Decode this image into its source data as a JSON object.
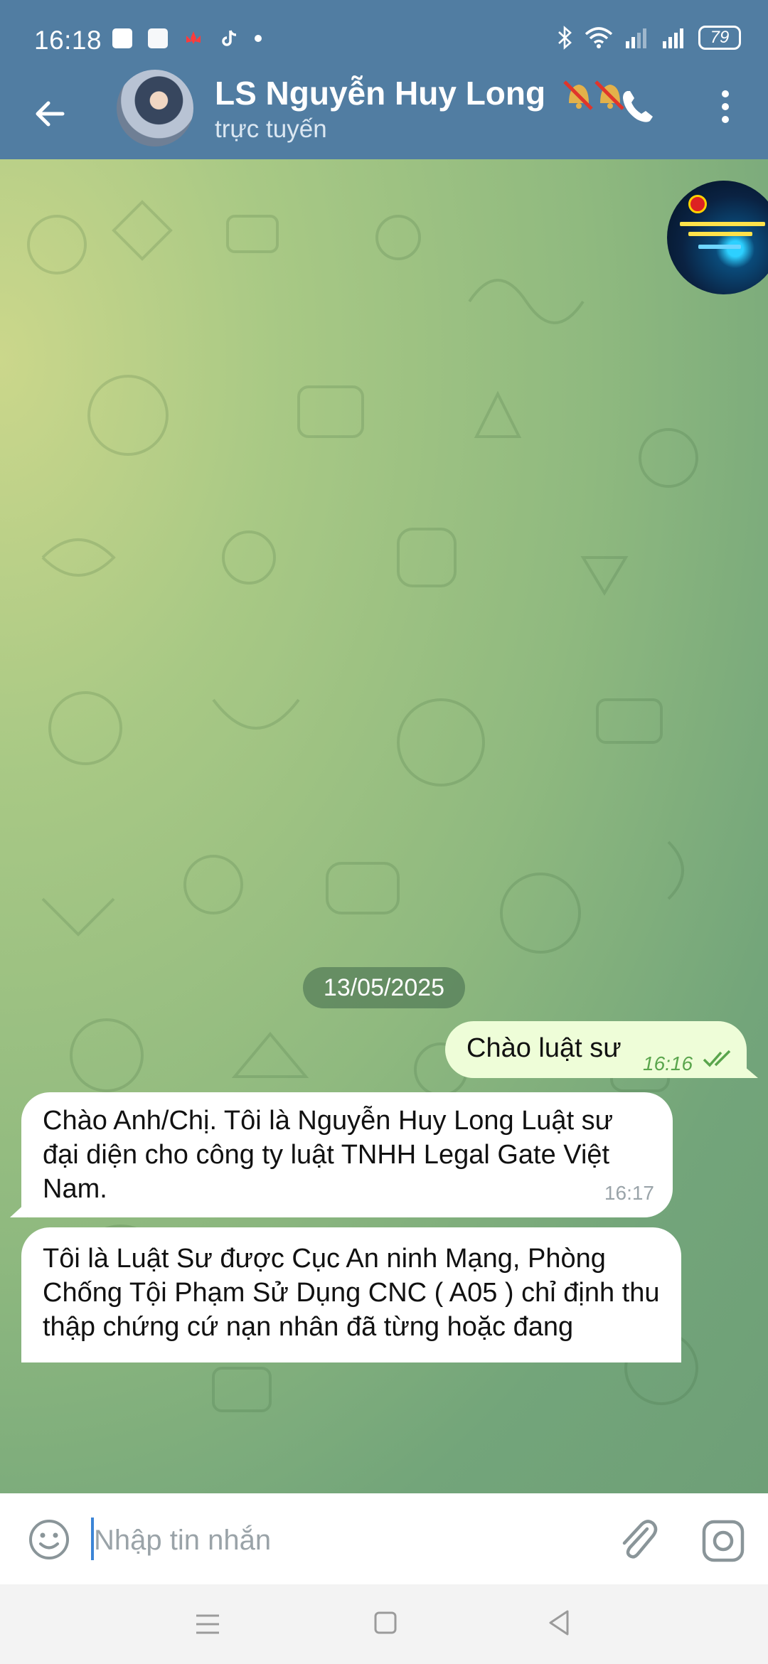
{
  "status_bar": {
    "time": "16:18",
    "battery": "79",
    "icons": [
      "shopee-icon",
      "app-icon",
      "lotus-icon",
      "tiktok-icon",
      "dot-icon",
      "bluetooth-icon",
      "wifi-icon",
      "signal-icon",
      "signal-icon",
      "battery-icon"
    ]
  },
  "header": {
    "title": "LS Nguyễn Huy Long",
    "status": "trực tuyến",
    "icons": [
      "back-arrow-icon",
      "avatar",
      "muted-bell-icon",
      "phone-icon",
      "more-vertical-icon"
    ]
  },
  "chat": {
    "date": "13/05/2025",
    "messages": [
      {
        "direction": "outgoing",
        "text": "Chào luật sư",
        "time": "16:16",
        "status": "read"
      },
      {
        "direction": "incoming",
        "text": "Chào Anh/Chị. Tôi là Nguyễn Huy Long Luật sư đại diện cho công ty luật TNHH Legal Gate Việt Nam.",
        "time": "16:17"
      },
      {
        "direction": "incoming",
        "text": "Tôi là Luật Sư được Cục An ninh Mạng, Phòng Chống Tội Phạm Sử Dụng CNC ( A05 ) chỉ định thu thập chứng cứ nạn nhân đã từng hoặc đang"
      }
    ]
  },
  "composer": {
    "placeholder": "Nhập tin nhắn"
  },
  "colors": {
    "header": "#517da2",
    "outgoing_bubble": "#eefdd8",
    "incoming_bubble": "#ffffff",
    "read_check": "#5aa54d"
  }
}
